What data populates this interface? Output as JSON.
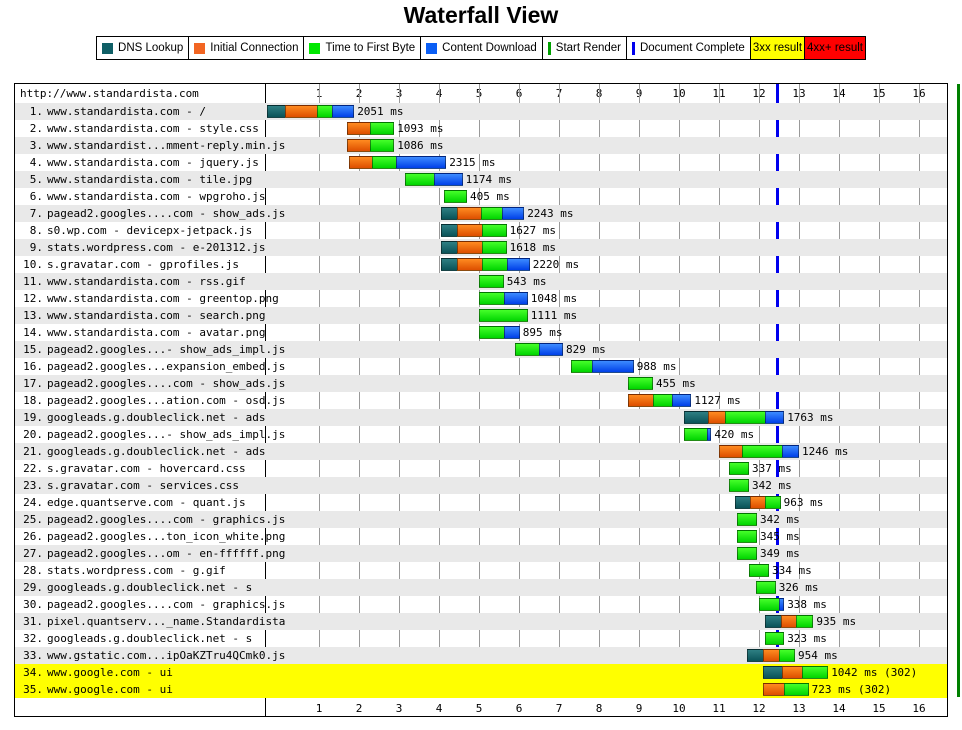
{
  "title": "Waterfall View",
  "legend": {
    "items": [
      {
        "label": "DNS Lookup",
        "color": "#0f5f66",
        "kind": "swatch",
        "name": "dns-lookup"
      },
      {
        "label": "Initial Connection",
        "color": "#f26522",
        "kind": "swatch",
        "name": "initial-connection"
      },
      {
        "label": "Time to First Byte",
        "color": "#00e800",
        "kind": "swatch",
        "name": "time-to-first-byte"
      },
      {
        "label": "Content Download",
        "color": "#0a5ef5",
        "kind": "swatch",
        "name": "content-download"
      },
      {
        "label": "Start Render",
        "color": "#00a000",
        "kind": "bar",
        "name": "start-render"
      },
      {
        "label": "Document Complete",
        "color": "#0000ee",
        "kind": "bar",
        "name": "document-complete"
      },
      {
        "label": "3xx result",
        "color": "#ffff00",
        "kind": "fill-3xx",
        "name": "3xx-result"
      },
      {
        "label": "4xx+ result",
        "color": "#ff0000",
        "kind": "fill-4xx",
        "name": "4xx-result"
      }
    ]
  },
  "chart_header": {
    "url": "http://www.standardista.com"
  },
  "chart_data": {
    "type": "bar",
    "title": "Waterfall View",
    "xlabel": "",
    "ylabel": "",
    "xlim": [
      0,
      17.075
    ],
    "x_ticks": [
      1,
      2,
      3,
      4,
      5,
      6,
      7,
      8,
      9,
      10,
      11,
      12,
      13,
      14,
      15,
      16
    ],
    "x_tick_labels": [
      "1",
      "2",
      "3",
      "4",
      "5",
      "6",
      "7",
      "8",
      "9",
      "10",
      "11",
      "12",
      "13",
      "14",
      "15",
      "16"
    ],
    "axis_units": "seconds",
    "grid": true,
    "legend_position": "top",
    "markers": [
      {
        "name": "document-complete",
        "value": 12.45,
        "color": "#0000ee"
      },
      {
        "name": "start-render",
        "value": 16.98,
        "color": "#008000"
      }
    ],
    "series": [
      {
        "name": "DNS Lookup",
        "color": "#0f5f66"
      },
      {
        "name": "Initial Connection",
        "color": "#f26522"
      },
      {
        "name": "Time to First Byte",
        "color": "#00e800"
      },
      {
        "name": "Content Download",
        "color": "#0a5ef5"
      }
    ],
    "rows": [
      {
        "n": "1.",
        "label": "www.standardista.com - /",
        "start": 0.0,
        "dns": 0.45,
        "conn": 0.8,
        "ttfb": 0.38,
        "cd": 0.55,
        "total": "2051 ms",
        "status": "ok"
      },
      {
        "n": "2.",
        "label": "www.standardista.com - style.css",
        "start": 2.0,
        "dns": 0,
        "conn": 0.58,
        "ttfb": 0.6,
        "cd": 0,
        "total": "1093 ms",
        "status": "ok"
      },
      {
        "n": "3.",
        "label": "www.standardist...mment-reply.min.js",
        "start": 2.0,
        "dns": 0,
        "conn": 0.58,
        "ttfb": 0.6,
        "cd": 0,
        "total": "1086 ms",
        "status": "ok"
      },
      {
        "n": "4.",
        "label": "www.standardista.com - jquery.js",
        "start": 2.05,
        "dns": 0,
        "conn": 0.58,
        "ttfb": 0.6,
        "cd": 1.25,
        "total": "2315 ms",
        "status": "ok"
      },
      {
        "n": "5.",
        "label": "www.standardista.com - tile.jpg",
        "start": 3.45,
        "dns": 0,
        "conn": 0,
        "ttfb": 0.72,
        "cd": 0.72,
        "total": "1174 ms",
        "status": "ok"
      },
      {
        "n": "6.",
        "label": "www.standardista.com - wpgroho.js",
        "start": 4.42,
        "dns": 0,
        "conn": 0,
        "ttfb": 0.58,
        "cd": 0,
        "total": "405 ms",
        "status": "ok"
      },
      {
        "n": "7.",
        "label": "pagead2.googles....com - show_ads.js",
        "start": 4.35,
        "dns": 0.4,
        "conn": 0.6,
        "ttfb": 0.52,
        "cd": 0.56,
        "total": "2243 ms",
        "status": "ok"
      },
      {
        "n": "8.",
        "label": "s0.wp.com - devicepx-jetpack.js",
        "start": 4.35,
        "dns": 0.4,
        "conn": 0.62,
        "ttfb": 0.62,
        "cd": 0,
        "total": "1627 ms",
        "status": "ok"
      },
      {
        "n": "9.",
        "label": "stats.wordpress.com - e-201312.js",
        "start": 4.35,
        "dns": 0.4,
        "conn": 0.62,
        "ttfb": 0.62,
        "cd": 0,
        "total": "1618 ms",
        "status": "ok"
      },
      {
        "n": "10.",
        "label": "s.gravatar.com - gprofiles.js",
        "start": 4.35,
        "dns": 0.4,
        "conn": 0.62,
        "ttfb": 0.62,
        "cd": 0.58,
        "total": "2220 ms",
        "status": "ok"
      },
      {
        "n": "11.",
        "label": "www.standardista.com - rss.gif",
        "start": 5.3,
        "dns": 0,
        "conn": 0,
        "ttfb": 0.62,
        "cd": 0,
        "total": "543 ms",
        "status": "ok"
      },
      {
        "n": "12.",
        "label": "www.standardista.com - greentop.png",
        "start": 5.3,
        "dns": 0,
        "conn": 0,
        "ttfb": 0.62,
        "cd": 0.6,
        "total": "1048 ms",
        "status": "ok"
      },
      {
        "n": "13.",
        "label": "www.standardista.com - search.png",
        "start": 5.3,
        "dns": 0,
        "conn": 0,
        "ttfb": 1.22,
        "cd": 0,
        "total": "1111 ms",
        "status": "ok"
      },
      {
        "n": "14.",
        "label": "www.standardista.com - avatar.png",
        "start": 5.3,
        "dns": 0,
        "conn": 0,
        "ttfb": 0.62,
        "cd": 0.4,
        "total": "895 ms",
        "status": "ok"
      },
      {
        "n": "15.",
        "label": "pagead2.googles...- show_ads_impl.js",
        "start": 6.2,
        "dns": 0,
        "conn": 0,
        "ttfb": 0.6,
        "cd": 0.6,
        "total": "829 ms",
        "status": "ok"
      },
      {
        "n": "16.",
        "label": "pagead2.googles...expansion_embed.js",
        "start": 7.6,
        "dns": 0,
        "conn": 0,
        "ttfb": 0.52,
        "cd": 1.05,
        "total": "988 ms",
        "status": "ok"
      },
      {
        "n": "17.",
        "label": "pagead2.googles....com - show_ads.js",
        "start": 9.03,
        "dns": 0,
        "conn": 0,
        "ttfb": 0.62,
        "cd": 0,
        "total": "455 ms",
        "status": "ok"
      },
      {
        "n": "18.",
        "label": "pagead2.googles...ation.com - osd.js",
        "start": 9.03,
        "dns": 0,
        "conn": 0.62,
        "ttfb": 0.48,
        "cd": 0.48,
        "total": "1127 ms",
        "status": "ok"
      },
      {
        "n": "19.",
        "label": "googleads.g.doubleclick.net - ads",
        "start": 10.43,
        "dns": 0.6,
        "conn": 0.42,
        "ttfb": 1.0,
        "cd": 0.48,
        "total": "1763 ms",
        "status": "ok"
      },
      {
        "n": "20.",
        "label": "pagead2.googles...- show_ads_impl.js",
        "start": 10.43,
        "dns": 0,
        "conn": 0,
        "ttfb": 0.56,
        "cd": 0.12,
        "total": "420 ms",
        "status": "ok"
      },
      {
        "n": "21.",
        "label": "googleads.g.doubleclick.net - ads",
        "start": 11.3,
        "dns": 0,
        "conn": 0.58,
        "ttfb": 1.0,
        "cd": 0.42,
        "total": "1246 ms",
        "status": "ok"
      },
      {
        "n": "22.",
        "label": "s.gravatar.com - hovercard.css",
        "start": 11.55,
        "dns": 0,
        "conn": 0,
        "ttfb": 0.5,
        "cd": 0,
        "total": "337 ms",
        "status": "ok"
      },
      {
        "n": "23.",
        "label": "s.gravatar.com - services.css",
        "start": 11.55,
        "dns": 0,
        "conn": 0,
        "ttfb": 0.5,
        "cd": 0,
        "total": "342 ms",
        "status": "ok"
      },
      {
        "n": "24.",
        "label": "edge.quantserve.com - quant.js",
        "start": 11.7,
        "dns": 0.38,
        "conn": 0.38,
        "ttfb": 0.38,
        "cd": 0,
        "total": "963 ms",
        "status": "ok"
      },
      {
        "n": "25.",
        "label": "pagead2.googles....com - graphics.js",
        "start": 11.75,
        "dns": 0,
        "conn": 0,
        "ttfb": 0.5,
        "cd": 0,
        "total": "342 ms",
        "status": "ok"
      },
      {
        "n": "26.",
        "label": "pagead2.googles...ton_icon_white.png",
        "start": 11.75,
        "dns": 0,
        "conn": 0,
        "ttfb": 0.5,
        "cd": 0,
        "total": "345 ms",
        "status": "ok"
      },
      {
        "n": "27.",
        "label": "pagead2.googles...om - en-ffffff.png",
        "start": 11.75,
        "dns": 0,
        "conn": 0,
        "ttfb": 0.5,
        "cd": 0,
        "total": "349 ms",
        "status": "ok"
      },
      {
        "n": "28.",
        "label": "stats.wordpress.com - g.gif",
        "start": 12.05,
        "dns": 0,
        "conn": 0,
        "ttfb": 0.5,
        "cd": 0,
        "total": "334 ms",
        "status": "ok"
      },
      {
        "n": "29.",
        "label": "googleads.g.doubleclick.net - s",
        "start": 12.22,
        "dns": 0,
        "conn": 0,
        "ttfb": 0.5,
        "cd": 0,
        "total": "326 ms",
        "status": "ok"
      },
      {
        "n": "30.",
        "label": "pagead2.googles....com - graphics.js",
        "start": 12.3,
        "dns": 0,
        "conn": 0,
        "ttfb": 0.5,
        "cd": 0.13,
        "total": "338 ms",
        "status": "ok"
      },
      {
        "n": "31.",
        "label": "pixel.quantserv..._name.Standardista",
        "start": 12.45,
        "dns": 0.4,
        "conn": 0.38,
        "ttfb": 0.43,
        "cd": 0,
        "total": "935 ms",
        "status": "ok"
      },
      {
        "n": "32.",
        "label": "googleads.g.doubleclick.net - s",
        "start": 12.45,
        "dns": 0,
        "conn": 0,
        "ttfb": 0.48,
        "cd": 0,
        "total": "323 ms",
        "status": "ok"
      },
      {
        "n": "33.",
        "label": "www.gstatic.com...ipOaKZTru4QCmk0.js",
        "start": 12.0,
        "dns": 0.4,
        "conn": 0.4,
        "ttfb": 0.4,
        "cd": 0,
        "total": "954 ms",
        "status": "ok"
      },
      {
        "n": "34.",
        "label": "www.google.com - ui",
        "start": 12.4,
        "dns": 0.48,
        "conn": 0.5,
        "ttfb": 0.65,
        "cd": 0,
        "total": "1042 ms (302)",
        "status": "3xx"
      },
      {
        "n": "35.",
        "label": "www.google.com - ui",
        "start": 12.4,
        "dns": 0,
        "conn": 0.52,
        "ttfb": 0.62,
        "cd": 0,
        "total": "723 ms (302)",
        "status": "3xx"
      }
    ]
  }
}
